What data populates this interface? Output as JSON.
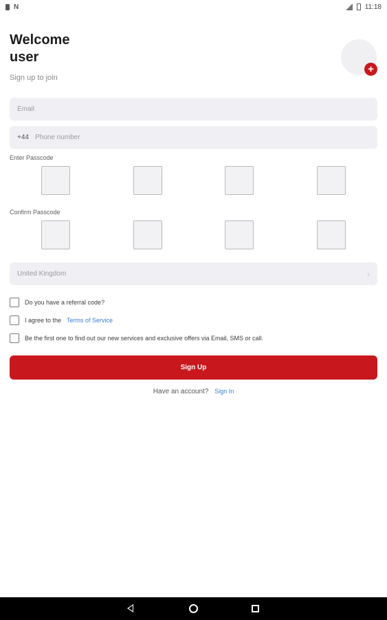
{
  "status_bar": {
    "time": "11:18",
    "icons": [
      "battery-saver-icon",
      "notification-n-icon",
      "signal-icon",
      "battery-icon"
    ]
  },
  "header": {
    "title": "Welcome user",
    "subtitle": "Sign up to join",
    "avatar_add_icon": "plus-circle-icon"
  },
  "form": {
    "email_placeholder": "Email",
    "phone_prefix": "+44",
    "phone_placeholder": "Phone number",
    "passcode_label": "Enter Passcode",
    "confirm_passcode_label": "Confirm Passcode",
    "pin_length": 4,
    "country_value": "United Kingdom",
    "checkboxes": {
      "referral": "Do you have a referral code?",
      "terms_prefix": "I agree to the",
      "terms_link": "Terms of Service",
      "marketing": "Be the first one to find out our new services and exclusive offers via Email, SMS or call."
    },
    "submit_label": "Sign Up",
    "have_account_text": "Have an account?",
    "signin_link": "Sign In"
  },
  "colors": {
    "accent": "#c8181e",
    "link": "#3a7bd5",
    "field_bg": "#f0f0f4"
  },
  "nav_bar": {
    "icons": [
      "back-icon",
      "home-icon",
      "recents-icon"
    ]
  }
}
